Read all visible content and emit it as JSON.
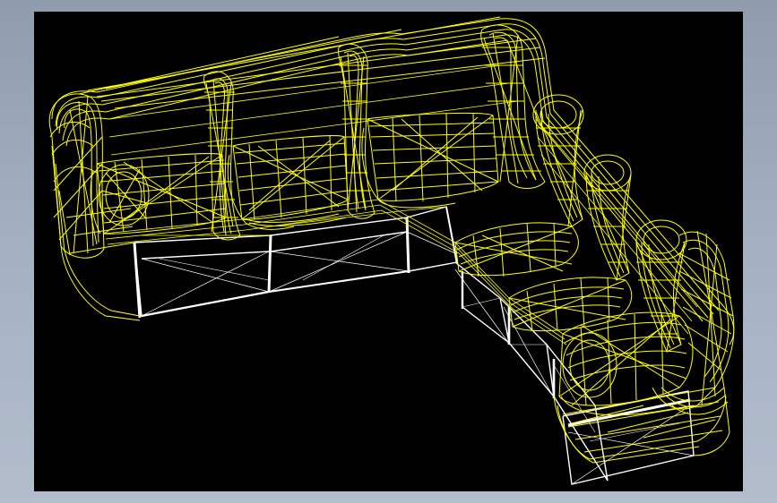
{
  "window": {
    "background": "#9aa6b8"
  },
  "viewport": {
    "background": "#000000",
    "wire_color": "#ffff00",
    "base_color": "#ffffff"
  },
  "model": {
    "render_style": "wireframe",
    "object": "l-shaped-sectional-sofa"
  },
  "icons": {
    "sofa": "sofa-wireframe-icon"
  }
}
